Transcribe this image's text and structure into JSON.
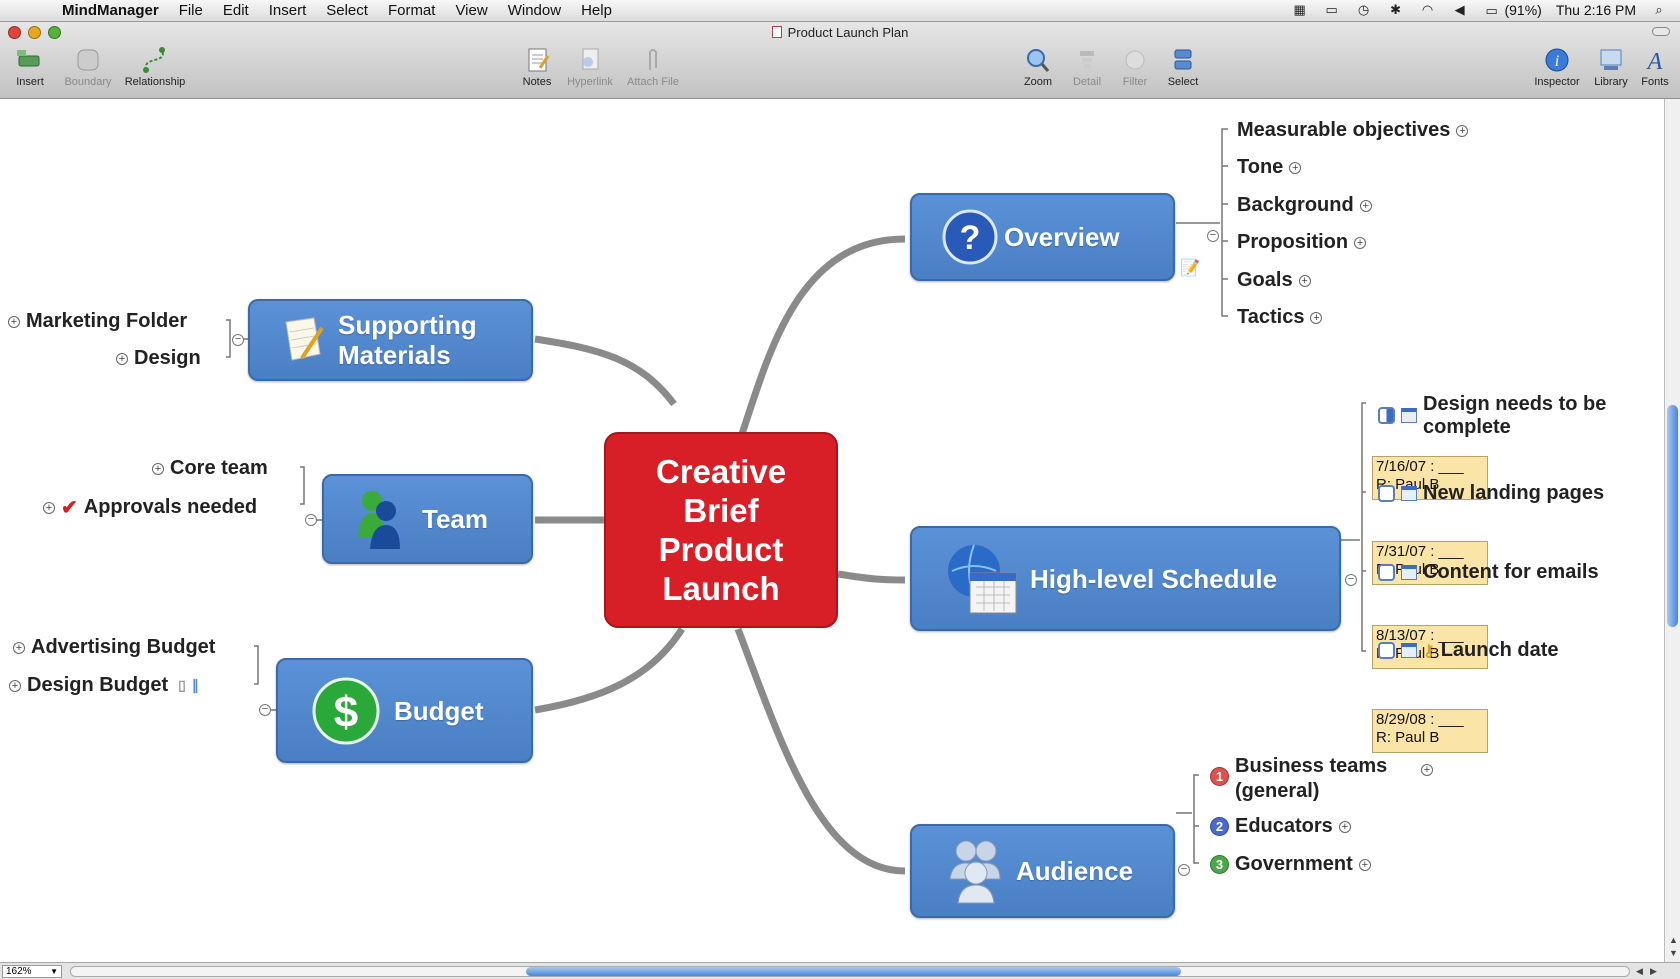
{
  "menubar": {
    "app": "MindManager",
    "items": [
      "File",
      "Edit",
      "Insert",
      "Select",
      "Format",
      "View",
      "Window",
      "Help"
    ],
    "battery": "(91%)",
    "clock": "Thu 2:16 PM"
  },
  "window": {
    "title": "Product Launch Plan"
  },
  "toolbar": {
    "insert": "Insert",
    "boundary": "Boundary",
    "relationship": "Relationship",
    "notes": "Notes",
    "hyperlink": "Hyperlink",
    "attach": "Attach File",
    "zoom": "Zoom",
    "detail": "Detail",
    "filter": "Filter",
    "select": "Select",
    "inspector": "Inspector",
    "library": "Library",
    "fonts": "Fonts"
  },
  "map": {
    "central": "Creative Brief Product Launch",
    "overview": {
      "label": "Overview",
      "children": [
        "Measurable objectives",
        "Tone",
        "Background",
        "Proposition",
        "Goals",
        "Tactics"
      ]
    },
    "supporting": {
      "label": "Supporting Materials",
      "children": [
        "Marketing Folder",
        "Design"
      ]
    },
    "team": {
      "label": "Team",
      "children": [
        "Core team",
        "Approvals needed"
      ]
    },
    "budget": {
      "label": "Budget",
      "children": [
        "Advertising Budget",
        "Design Budget"
      ]
    },
    "schedule": {
      "label": "High-level Schedule",
      "tasks": [
        {
          "name": "Design needs to be complete",
          "date": "7/16/07 : ___",
          "resource": "R: Paul B"
        },
        {
          "name": "New landing pages",
          "date": "7/31/07 : ___",
          "resource": "R: Paul B"
        },
        {
          "name": "Content for emails",
          "date": "8/13/07 : ___",
          "resource": "R: Paul B"
        },
        {
          "name": "Launch date",
          "date": "8/29/08 : ___",
          "resource": "R: Paul B"
        }
      ]
    },
    "audience": {
      "label": "Audience",
      "children": [
        {
          "name": "Business teams (general)",
          "priority": "1",
          "color": "#e05050"
        },
        {
          "name": "Educators",
          "priority": "2",
          "color": "#4a6ad0"
        },
        {
          "name": "Government",
          "priority": "3",
          "color": "#4aa84a"
        }
      ]
    }
  },
  "status": {
    "zoom_level": "162%"
  },
  "colors": {
    "central": "#d81e26",
    "topic": "#4a7fc4",
    "task_note": "#fbe4a8"
  }
}
